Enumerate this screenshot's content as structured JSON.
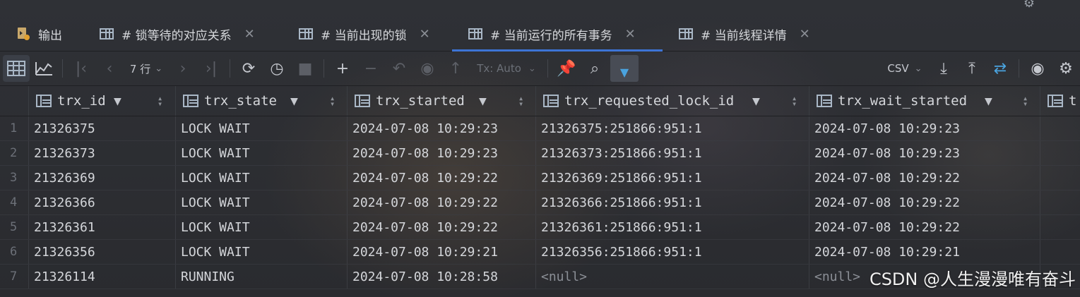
{
  "tabs": [
    {
      "label": "输出",
      "icon": "output-icon",
      "active": false
    },
    {
      "label": "#  锁等待的对应关系",
      "icon": "table-icon",
      "active": false
    },
    {
      "label": "# 当前出现的锁",
      "icon": "table-icon",
      "active": false
    },
    {
      "label": "# 当前运行的所有事务",
      "icon": "table-icon",
      "active": true
    },
    {
      "label": "# 当前线程详情",
      "icon": "table-icon",
      "active": false
    }
  ],
  "toolbar": {
    "rows_label": "7 行",
    "tx_mode": "Tx: Auto",
    "export_format": "CSV"
  },
  "columns": [
    {
      "name": "trx_id"
    },
    {
      "name": "trx_state"
    },
    {
      "name": "trx_started"
    },
    {
      "name": "trx_requested_lock_id"
    },
    {
      "name": "trx_wait_started"
    },
    {
      "name": "t"
    }
  ],
  "rows": [
    {
      "n": "1",
      "trx_id": "21326375",
      "trx_state": "LOCK WAIT",
      "trx_started": "2024-07-08 10:29:23",
      "trx_requested_lock_id": "21326375:251866:951:1",
      "trx_wait_started": "2024-07-08 10:29:23"
    },
    {
      "n": "2",
      "trx_id": "21326373",
      "trx_state": "LOCK WAIT",
      "trx_started": "2024-07-08 10:29:23",
      "trx_requested_lock_id": "21326373:251866:951:1",
      "trx_wait_started": "2024-07-08 10:29:23"
    },
    {
      "n": "3",
      "trx_id": "21326369",
      "trx_state": "LOCK WAIT",
      "trx_started": "2024-07-08 10:29:22",
      "trx_requested_lock_id": "21326369:251866:951:1",
      "trx_wait_started": "2024-07-08 10:29:22"
    },
    {
      "n": "4",
      "trx_id": "21326366",
      "trx_state": "LOCK WAIT",
      "trx_started": "2024-07-08 10:29:22",
      "trx_requested_lock_id": "21326366:251866:951:1",
      "trx_wait_started": "2024-07-08 10:29:22"
    },
    {
      "n": "5",
      "trx_id": "21326361",
      "trx_state": "LOCK WAIT",
      "trx_started": "2024-07-08 10:29:22",
      "trx_requested_lock_id": "21326361:251866:951:1",
      "trx_wait_started": "2024-07-08 10:29:22"
    },
    {
      "n": "6",
      "trx_id": "21326356",
      "trx_state": "LOCK WAIT",
      "trx_started": "2024-07-08 10:29:21",
      "trx_requested_lock_id": "21326356:251866:951:1",
      "trx_wait_started": "2024-07-08 10:29:21"
    },
    {
      "n": "7",
      "trx_id": "21326114",
      "trx_state": "RUNNING",
      "trx_started": "2024-07-08 10:28:58",
      "trx_requested_lock_id": "<null>",
      "trx_wait_started": "<null>"
    }
  ],
  "watermark": "CSDN @人生漫漫唯有奋斗",
  "colors": {
    "accent": "#3d74d6",
    "background": "#2b2d30",
    "filter_active": "#4aa3df"
  }
}
